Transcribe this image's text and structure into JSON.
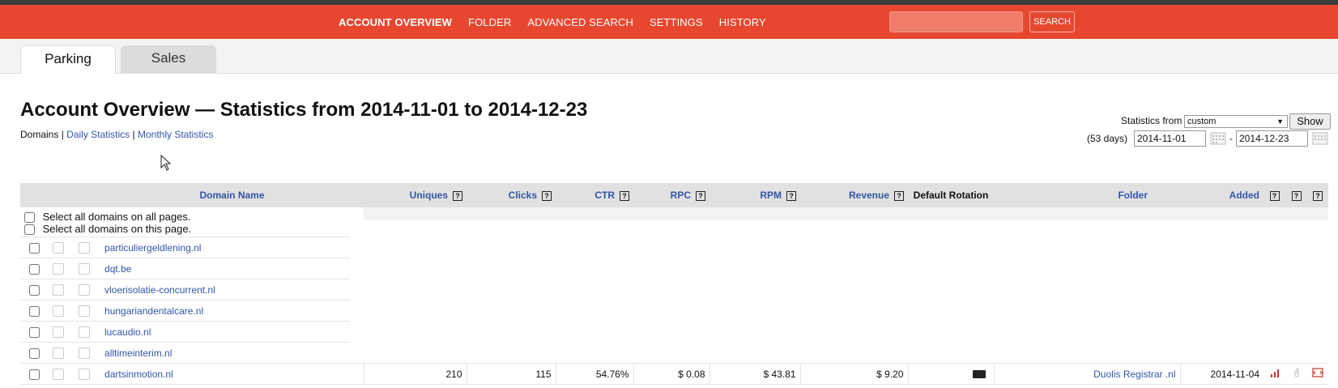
{
  "nav": {
    "links": [
      "ACCOUNT OVERVIEW",
      "FOLDER",
      "ADVANCED SEARCH",
      "SETTINGS",
      "HISTORY"
    ],
    "search_placeholder": "",
    "search_button": "SEARCH"
  },
  "tabs": [
    "Parking",
    "Sales"
  ],
  "page_title": "Account Overview — Statistics from 2014-11-01 to 2014-12-23",
  "sublinks": {
    "current": "Domains",
    "sep": " | ",
    "daily": "Daily Statistics",
    "monthly": "Monthly Statistics"
  },
  "stats": {
    "label": "Statistics from",
    "select_value": "custom",
    "show_button": "Show",
    "days": "(53 days)",
    "from": "2014-11-01",
    "dash": "-",
    "to": "2014-12-23"
  },
  "table": {
    "headers": [
      "Domain Name",
      "Uniques",
      "Clicks",
      "CTR",
      "RPC",
      "RPM",
      "Revenue",
      "Default Rotation",
      "Folder",
      "Added"
    ],
    "help_glyph": "?",
    "select_all_pages": "Select all domains on all pages.",
    "select_all_this": "Select all domains on this page.",
    "domains": [
      "particuliergeldlening.nl",
      "dqt.be",
      "vloerisolatie-concurrent.nl",
      "hungariandentalcare.nl",
      "lucaudio.nl",
      "alltimeinterim.nl"
    ],
    "full_row": {
      "domain": "dartsinmotion.nl",
      "uniques": "210",
      "clicks": "115",
      "ctr": "54.76%",
      "rpc": "$ 0.08",
      "rpm": "$ 43.81",
      "revenue": "$ 9.20",
      "folder": "Duolis Registrar .nl",
      "added": "2014-11-04"
    }
  },
  "colors": {
    "brand": "#e8472f",
    "link": "#3355aa",
    "header_bg": "#e1e1e1"
  }
}
